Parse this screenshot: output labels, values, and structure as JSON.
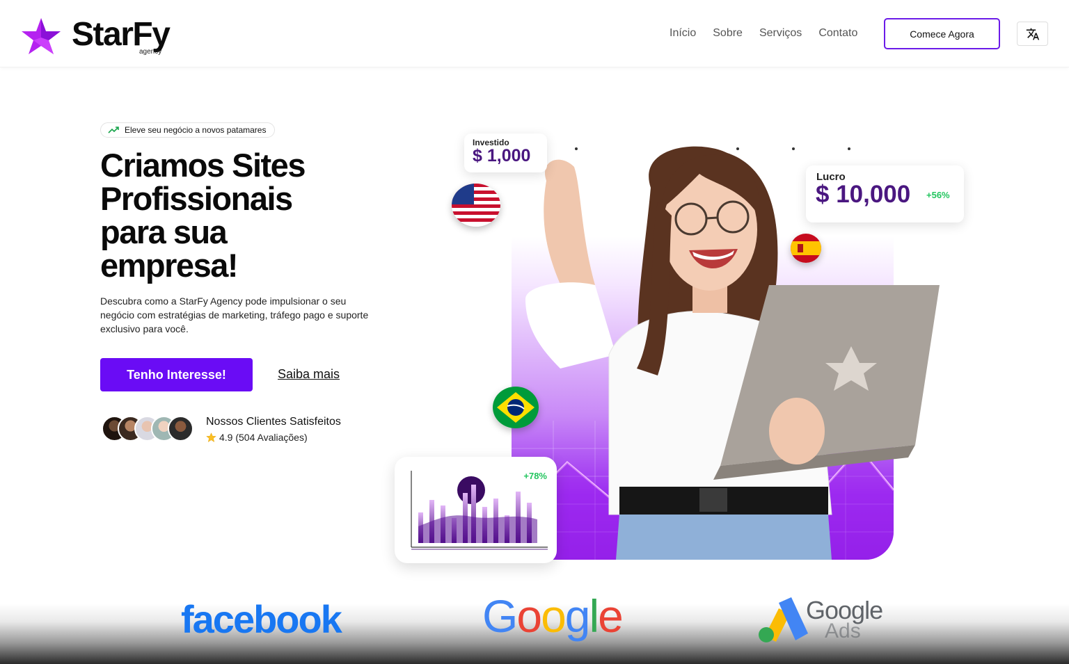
{
  "brand": {
    "name": "StarFy",
    "sub": "agency",
    "colors": {
      "accent": "#6a0cf5",
      "logo": "#b522f0",
      "dark": "#0b0b0b"
    }
  },
  "nav": {
    "items": [
      {
        "label": "Início"
      },
      {
        "label": "Sobre"
      },
      {
        "label": "Serviços"
      },
      {
        "label": "Contato"
      }
    ],
    "cta_label": "Comece Agora",
    "lang_icon": "translate-icon"
  },
  "hero": {
    "pill_text": "Eleve seu negócio a novos patamares",
    "pill_icon": "trending-up-icon",
    "title_lines": [
      "Criamos Sites",
      "Profissionais",
      "para sua",
      "empresa!"
    ],
    "description": "Descubra como a StarFy Agency pode impulsionar o seu negócio com estratégias de marketing, tráfego pago e suporte exclusivo para você.",
    "primary_button": "Tenho Interesse!",
    "secondary_button": "Saiba mais",
    "clients_title": "Nossos Clientes Satisfeitos",
    "rating_text": "4.9 (504 Avaliações)",
    "rating_icon": "star-icon"
  },
  "visual": {
    "invested_label": "Investido",
    "invested_value": "$ 1,000",
    "profit_label": "Lucro",
    "profit_value": "$ 10,000",
    "profit_gain": "+56%",
    "chart_gain": "+78%",
    "flags": [
      "flag-usa-icon",
      "flag-spain-icon",
      "flag-brazil-icon"
    ]
  },
  "partners": {
    "facebook": "facebook",
    "google_letters": [
      "G",
      "o",
      "o",
      "g",
      "l",
      "e"
    ],
    "google_colors": [
      "#4285F4",
      "#EA4335",
      "#FBBC05",
      "#4285F4",
      "#34A853",
      "#EA4335"
    ],
    "google_ads_line1": "Google",
    "google_ads_line2": "Ads"
  }
}
